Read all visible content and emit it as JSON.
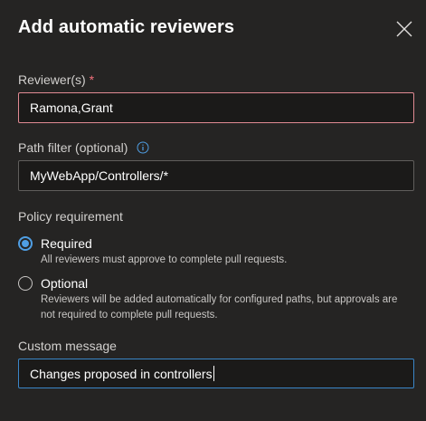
{
  "dialog": {
    "title": "Add automatic reviewers",
    "close_icon": "close-icon"
  },
  "reviewers": {
    "label": "Reviewer(s)",
    "required_marker": "*",
    "value": "Ramona,Grant"
  },
  "path_filter": {
    "label": "Path filter (optional)",
    "info_icon": "info-icon",
    "value": "MyWebApp/Controllers/*"
  },
  "policy": {
    "label": "Policy requirement",
    "options": [
      {
        "label": "Required",
        "description": "All reviewers must approve to complete pull requests.",
        "selected": true
      },
      {
        "label": "Optional",
        "description": "Reviewers will be added automatically for configured paths, but approvals are not required to complete pull requests.",
        "selected": false
      }
    ]
  },
  "custom_message": {
    "label": "Custom message",
    "value": "Changes proposed in controllers"
  },
  "colors": {
    "background": "#252423",
    "input_background": "#1b1a19",
    "accent": "#4f9ee3",
    "error_border": "#e18a93",
    "focus_border": "#3a86c8"
  }
}
